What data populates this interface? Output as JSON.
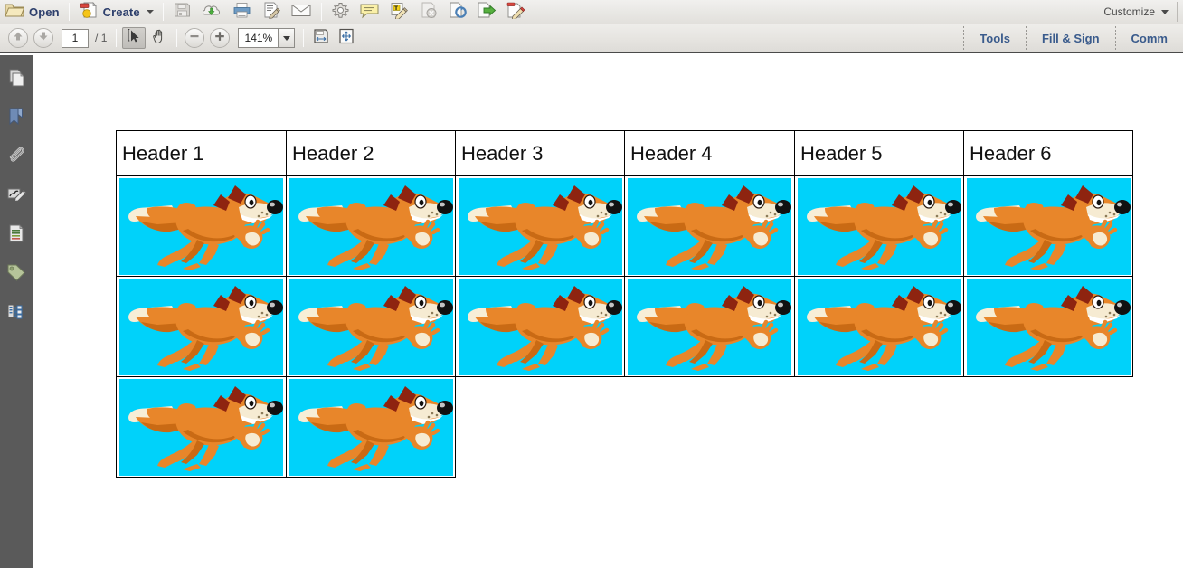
{
  "app": {
    "toolbar_top": {
      "open_label": "Open",
      "create_label": "Create",
      "customize_label": "Customize",
      "icons": [
        {
          "name": "open-folder-icon",
          "label": "Open"
        },
        {
          "name": "create-document-icon",
          "label": "Create"
        },
        {
          "name": "save-icon",
          "label": "Save"
        },
        {
          "name": "upload-cloud-icon",
          "label": "Send files"
        },
        {
          "name": "print-icon",
          "label": "Print"
        },
        {
          "name": "sign-document-icon",
          "label": "Sign"
        },
        {
          "name": "email-icon",
          "label": "Email"
        },
        {
          "name": "gear-icon",
          "label": "Settings"
        },
        {
          "name": "comment-bubble-icon",
          "label": "Sticky Note"
        },
        {
          "name": "highlight-text-icon",
          "label": "Highlight Text"
        },
        {
          "name": "stamp-disabled-icon",
          "label": "Stamp"
        },
        {
          "name": "rotate-view-icon",
          "label": "Rotate"
        },
        {
          "name": "export-icon",
          "label": "Export"
        },
        {
          "name": "edit-pdf-icon",
          "label": "Edit PDF"
        }
      ]
    },
    "toolbar_nav": {
      "page_current": "1",
      "page_separator": "/",
      "page_total": "1",
      "zoom_level": "141%",
      "icons": [
        {
          "name": "previous-page-icon",
          "label": "Previous Page"
        },
        {
          "name": "next-page-icon",
          "label": "Next Page"
        },
        {
          "name": "select-tool-icon",
          "label": "Select Tool"
        },
        {
          "name": "hand-tool-icon",
          "label": "Hand Tool"
        },
        {
          "name": "zoom-out-icon",
          "label": "Zoom Out"
        },
        {
          "name": "zoom-in-icon",
          "label": "Zoom In"
        },
        {
          "name": "fit-width-icon",
          "label": "Fit Width"
        },
        {
          "name": "fit-page-icon",
          "label": "Fit Page"
        }
      ],
      "links": [
        {
          "name": "tools-link",
          "label": "Tools"
        },
        {
          "name": "fill-and-sign-link",
          "label": "Fill & Sign"
        },
        {
          "name": "comment-link",
          "label": "Comm"
        }
      ]
    },
    "sidebar": {
      "items": [
        {
          "name": "page-thumbnails-icon",
          "label": "Page Thumbnails"
        },
        {
          "name": "bookmarks-icon",
          "label": "Bookmarks"
        },
        {
          "name": "attachments-icon",
          "label": "Attachments"
        },
        {
          "name": "signatures-icon",
          "label": "Signatures"
        },
        {
          "name": "content-icon",
          "label": "Content"
        },
        {
          "name": "tags-icon",
          "label": "Tags"
        },
        {
          "name": "model-tree-icon",
          "label": "Model Tree"
        }
      ]
    }
  },
  "document": {
    "table": {
      "headers": [
        "Header 1",
        "Header 2",
        "Header 3",
        "Header 4",
        "Header 5",
        "Header 6"
      ],
      "rows": [
        {
          "cells": [
            "fox",
            "fox",
            "fox",
            "fox",
            "fox",
            "fox"
          ]
        },
        {
          "cells": [
            "fox",
            "fox",
            "fox",
            "fox",
            "fox",
            "fox"
          ]
        },
        {
          "cells": [
            "fox",
            "fox"
          ]
        }
      ],
      "image_alt": "running-fox",
      "image_background_color": "#00D2FA"
    }
  },
  "colors": {
    "toolbar_background": "#e8e6e2",
    "sidebar_background": "#5a5a5a",
    "link_blue": "#3a5b8c",
    "page_white": "#ffffff",
    "fox_orange": "#E8862A",
    "fox_dark_red": "#8E2410",
    "fox_cream": "#F6EBD2",
    "cyan_background": "#00D2FA"
  }
}
